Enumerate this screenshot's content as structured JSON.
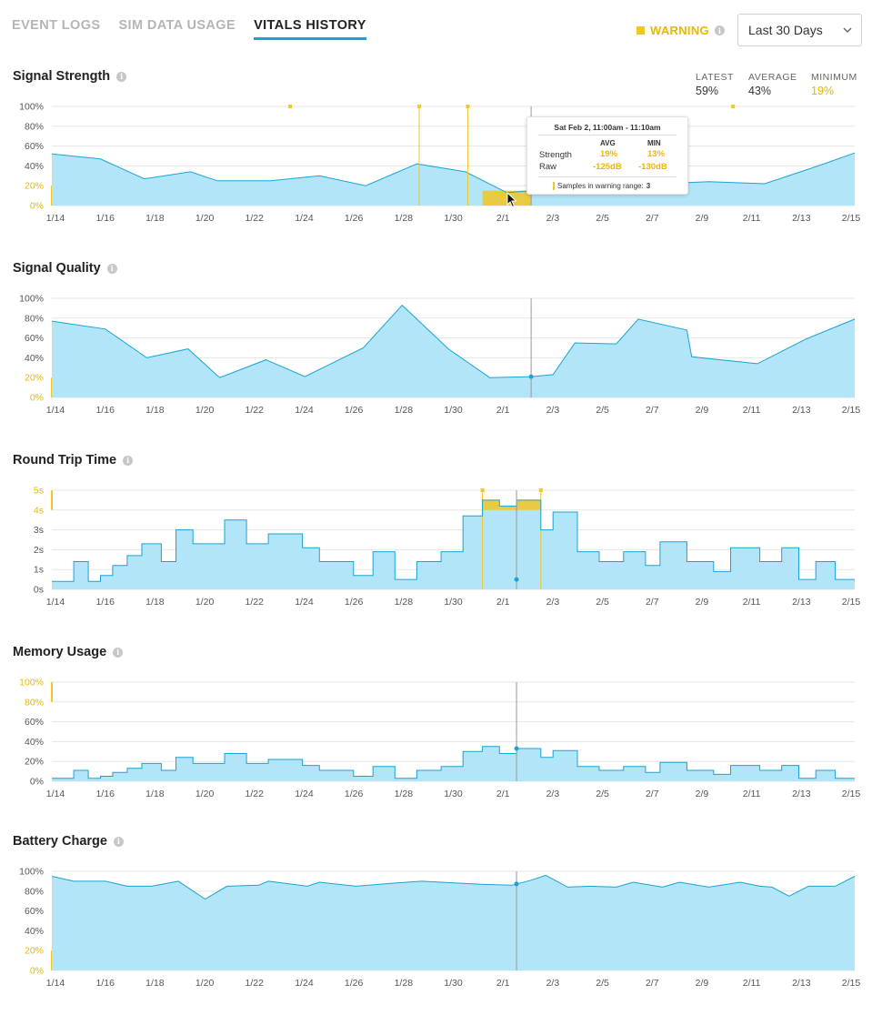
{
  "tabs": [
    {
      "label": "EVENT LOGS",
      "active": false
    },
    {
      "label": "SIM DATA USAGE",
      "active": false
    },
    {
      "label": "VITALS HISTORY",
      "active": true
    }
  ],
  "warning_legend": {
    "label": "WARNING",
    "color": "#f2c623"
  },
  "range_select": {
    "selected": "Last 30 Days"
  },
  "stats": {
    "latest_label": "LATEST",
    "latest_value": "59%",
    "average_label": "AVERAGE",
    "average_value": "43%",
    "minimum_label": "MINIMUM",
    "minimum_value": "19%"
  },
  "tooltip": {
    "title": "Sat Feb 2, 11:00am - 11:10am",
    "col_avg": "AVG",
    "col_min": "MIN",
    "row1_label": "Strength",
    "row1_avg": "19%",
    "row1_min": "13%",
    "row2_label": "Raw",
    "row2_avg": "-125dB",
    "row2_min": "-130dB",
    "footer_text": "Samples in warning range:",
    "footer_count": "3"
  },
  "colors": {
    "area_fill": "#b3e5f8",
    "line": "#1aa3d6",
    "warning": "#f2c623",
    "grid": "#e6e6e6",
    "cursor_line": "#999999"
  },
  "chart_data": [
    {
      "type": "area",
      "title": "Signal Strength",
      "x_tick_labels": [
        "1/14",
        "1/16",
        "1/18",
        "1/20",
        "1/22",
        "1/24",
        "1/26",
        "1/28",
        "1/30",
        "2/1",
        "2/3",
        "2/5",
        "2/7",
        "2/9",
        "2/11",
        "2/13",
        "2/15"
      ],
      "y_tick_labels": [
        "0%",
        "20%",
        "40%",
        "60%",
        "80%",
        "100%"
      ],
      "ylim": [
        0,
        100
      ],
      "warning_threshold": 20,
      "x": [
        0,
        2,
        3.8,
        5.7,
        6.8,
        9,
        11,
        12.9,
        15,
        17,
        18.7,
        19.7,
        20.3,
        21.7,
        22,
        24,
        25,
        27,
        29.3,
        31.5,
        33
      ],
      "values": [
        52,
        47,
        27,
        34,
        25,
        25,
        30,
        20,
        42,
        34,
        13,
        15,
        17,
        17,
        23,
        20,
        22,
        24,
        22,
        40,
        53
      ],
      "cursor_x": 19.7,
      "warning_markers_x": [
        9.8,
        15.1,
        17.1,
        28
      ]
    },
    {
      "type": "area",
      "title": "Signal Quality",
      "x_tick_labels": [
        "1/14",
        "1/16",
        "1/18",
        "1/20",
        "1/22",
        "1/24",
        "1/26",
        "1/28",
        "1/30",
        "2/1",
        "2/3",
        "2/5",
        "2/7",
        "2/9",
        "2/11",
        "2/13",
        "2/15"
      ],
      "y_tick_labels": [
        "0%",
        "20%",
        "40%",
        "60%",
        "80%",
        "100%"
      ],
      "ylim": [
        0,
        100
      ],
      "warning_threshold": 20,
      "x": [
        0,
        2.2,
        3.9,
        5.6,
        6.9,
        8.8,
        10.4,
        12.8,
        14.4,
        16.3,
        18,
        19.7,
        20.6,
        21.5,
        23.2,
        24.1,
        26.1,
        26.3,
        29,
        31,
        33
      ],
      "values": [
        77,
        69,
        40,
        49,
        20,
        38,
        21,
        50,
        93,
        49,
        20,
        21,
        23,
        55,
        54,
        79,
        68,
        41,
        34,
        59,
        79
      ],
      "cursor_x": 19.7
    },
    {
      "type": "area",
      "title": "Round Trip Time",
      "x_tick_labels": [
        "1/14",
        "1/16",
        "1/18",
        "1/20",
        "1/22",
        "1/24",
        "1/26",
        "1/28",
        "1/30",
        "2/1",
        "2/3",
        "2/5",
        "2/7",
        "2/9",
        "2/11",
        "2/13",
        "2/15"
      ],
      "y_tick_labels": [
        "0s",
        "1s",
        "2s",
        "3s",
        "4s",
        "5s"
      ],
      "ylim": [
        0,
        5
      ],
      "warning_threshold": 4,
      "step_x": [
        0,
        0.9,
        1.5,
        2,
        2.5,
        3.1,
        3.7,
        4.5,
        5.1,
        5.8,
        7.1,
        8,
        8.9,
        10.3,
        11,
        12.4,
        13.2,
        14.1,
        15,
        16,
        16.9,
        17.7,
        18.4,
        19.1,
        20.1,
        20.6,
        21.6,
        22.5,
        23.5,
        24.4,
        25,
        26.1,
        27.2,
        27.9,
        29.1,
        30,
        30.7,
        31.4,
        32.2,
        33
      ],
      "step_values": [
        0.4,
        1.4,
        0.4,
        0.7,
        1.2,
        1.7,
        2.3,
        1.4,
        3.0,
        2.3,
        3.5,
        2.3,
        2.8,
        2.1,
        1.4,
        0.7,
        1.9,
        0.5,
        1.4,
        1.9,
        3.7,
        4.5,
        4.2,
        4.5,
        3.0,
        3.9,
        1.9,
        1.4,
        1.9,
        1.2,
        2.4,
        1.4,
        0.9,
        2.1,
        1.4,
        2.1,
        0.5,
        1.4,
        0.5
      ],
      "cursor_x": 19.1,
      "warning_region_x": [
        17.7,
        20.1
      ]
    },
    {
      "type": "area",
      "title": "Memory Usage",
      "x_tick_labels": [
        "1/14",
        "1/16",
        "1/18",
        "1/20",
        "1/22",
        "1/24",
        "1/26",
        "1/28",
        "1/30",
        "2/1",
        "2/3",
        "2/5",
        "2/7",
        "2/9",
        "2/11",
        "2/13",
        "2/15"
      ],
      "y_tick_labels": [
        "0%",
        "20%",
        "40%",
        "60%",
        "80%",
        "100%"
      ],
      "ylim": [
        0,
        100
      ],
      "warning_threshold": 80,
      "step_x": [
        0,
        0.9,
        1.5,
        2,
        2.5,
        3.1,
        3.7,
        4.5,
        5.1,
        5.8,
        7.1,
        8,
        8.9,
        10.3,
        11,
        12.4,
        13.2,
        14.1,
        15,
        16,
        16.9,
        17.7,
        18.4,
        19.1,
        20.1,
        20.6,
        21.6,
        22.5,
        23.5,
        24.4,
        25,
        26.1,
        27.2,
        27.9,
        29.1,
        30,
        30.7,
        31.4,
        32.2,
        33
      ],
      "step_values": [
        3,
        11,
        3,
        5,
        9,
        13,
        18,
        11,
        24,
        18,
        28,
        18,
        22,
        16,
        11,
        5,
        15,
        3,
        11,
        15,
        30,
        35,
        28,
        33,
        24,
        31,
        15,
        11,
        15,
        9,
        19,
        11,
        7,
        16,
        11,
        16,
        3,
        11,
        3
      ],
      "cursor_x": 19.1
    },
    {
      "type": "area",
      "title": "Battery Charge",
      "x_tick_labels": [
        "1/14",
        "1/16",
        "1/18",
        "1/20",
        "1/22",
        "1/24",
        "1/26",
        "1/28",
        "1/30",
        "2/1",
        "2/3",
        "2/5",
        "2/7",
        "2/9",
        "2/11",
        "2/13",
        "2/15"
      ],
      "y_tick_labels": [
        "0%",
        "20%",
        "40%",
        "60%",
        "80%",
        "100%"
      ],
      "ylim": [
        0,
        100
      ],
      "warning_threshold": 20,
      "x": [
        0,
        0.9,
        2.2,
        3.1,
        4.1,
        5.2,
        6.3,
        7.2,
        8.5,
        8.9,
        10.5,
        11,
        12.5,
        14,
        15.2,
        16.8,
        17.6,
        18.9,
        19.7,
        20.3,
        21.2,
        22.1,
        23.2,
        23.9,
        25.1,
        25.8,
        27,
        28.3,
        29.1,
        29.6,
        30.3,
        31.1,
        32.2,
        33
      ],
      "values": [
        95,
        90,
        90,
        85,
        85,
        90,
        72,
        85,
        86,
        90,
        85,
        89,
        85,
        88,
        90,
        88,
        87,
        86,
        91,
        96,
        84,
        85,
        84,
        89,
        84,
        89,
        84,
        89,
        85,
        84,
        75,
        85,
        85,
        95
      ],
      "cursor_x": 19.1
    }
  ]
}
